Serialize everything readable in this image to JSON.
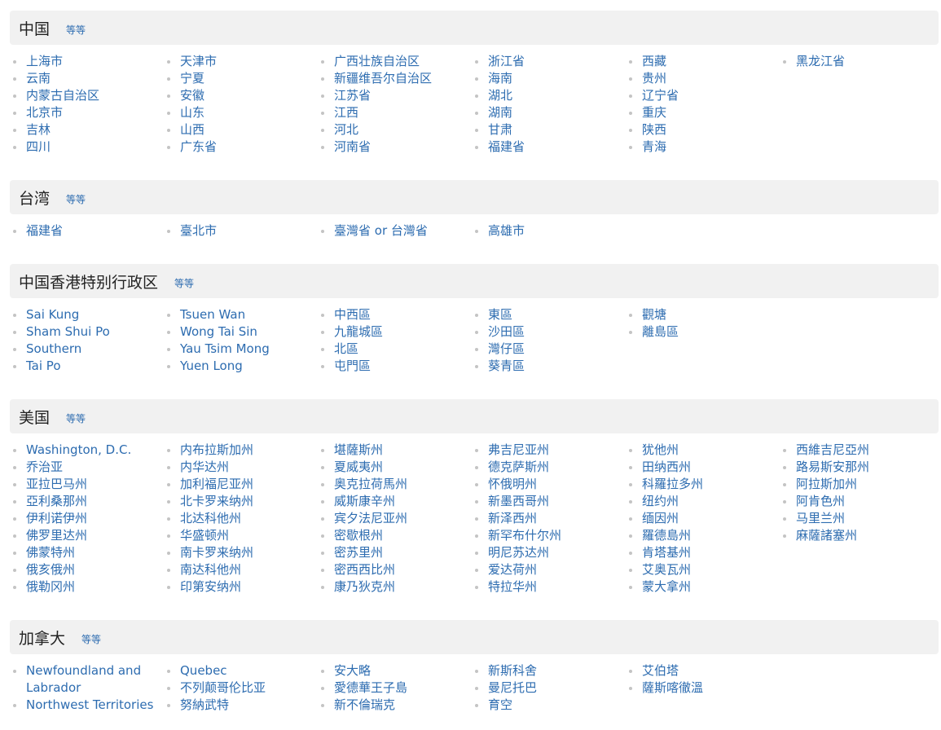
{
  "sections": [
    {
      "title": "中国",
      "more": "等等",
      "columns": [
        [
          "上海市",
          "云南",
          "内蒙古自治区",
          "北京市",
          "吉林",
          "四川"
        ],
        [
          "天津市",
          "宁夏",
          "安徽",
          "山东",
          "山西",
          "广东省"
        ],
        [
          "广西壮族自治区",
          "新疆维吾尔自治区",
          "江苏省",
          "江西",
          "河北",
          "河南省"
        ],
        [
          "浙江省",
          "海南",
          "湖北",
          "湖南",
          "甘肃",
          "福建省"
        ],
        [
          "西藏",
          "贵州",
          "辽宁省",
          "重庆",
          "陕西",
          "青海"
        ],
        [
          "黑龙江省"
        ]
      ]
    },
    {
      "title": "台湾",
      "more": "等等",
      "columns": [
        [
          "福建省"
        ],
        [
          "臺北市"
        ],
        [
          "臺灣省 or 台灣省"
        ],
        [
          "高雄市"
        ]
      ]
    },
    {
      "title": "中国香港特别行政区",
      "more": "等等",
      "columns": [
        [
          "Sai Kung",
          "Sham Shui Po",
          "Southern",
          "Tai Po"
        ],
        [
          "Tsuen Wan",
          "Wong Tai Sin",
          "Yau Tsim Mong",
          "Yuen Long"
        ],
        [
          "中西區",
          "九龍城區",
          "北區",
          "屯門區"
        ],
        [
          "東區",
          "沙田區",
          "灣仔區",
          "葵青區"
        ],
        [
          "觀塘",
          "離島區"
        ]
      ]
    },
    {
      "title": "美国",
      "more": "等等",
      "columns": [
        [
          "Washington, D.C.",
          "乔治亚",
          "亚拉巴马州",
          "亞利桑那州",
          "伊利诺伊州",
          "佛罗里达州",
          "佛蒙特州",
          "俄亥俄州",
          "俄勒冈州"
        ],
        [
          "内布拉斯加州",
          "内华达州",
          "加利福尼亚州",
          "北卡罗来纳州",
          "北达科他州",
          "华盛顿州",
          "南卡罗来纳州",
          "南达科他州",
          "印第安纳州"
        ],
        [
          "堪薩斯州",
          "夏威夷州",
          "奥克拉荷馬州",
          "威斯康辛州",
          "宾夕法尼亚州",
          "密歇根州",
          "密苏里州",
          "密西西比州",
          "康乃狄克州"
        ],
        [
          "弗吉尼亚州",
          "德克萨斯州",
          "怀俄明州",
          "新墨西哥州",
          "新泽西州",
          "新罕布什尔州",
          "明尼苏达州",
          "爱达荷州",
          "特拉华州"
        ],
        [
          "犹他州",
          "田纳西州",
          "科羅拉多州",
          "纽约州",
          "缅因州",
          "羅德島州",
          "肯塔基州",
          "艾奥瓦州",
          "蒙大拿州"
        ],
        [
          "西維吉尼亞州",
          "路易斯安那州",
          "阿拉斯加州",
          "阿肯色州",
          "马里兰州",
          "麻薩諸塞州"
        ]
      ]
    },
    {
      "title": "加拿大",
      "more": "等等",
      "columns": [
        [
          "Newfoundland and Labrador",
          "Northwest Territories"
        ],
        [
          "Quebec",
          "不列颠哥伦比亚",
          "努納武特"
        ],
        [
          "安大略",
          "愛德華王子島",
          "新不倫瑞克"
        ],
        [
          "新斯科舍",
          "曼尼托巴",
          "育空"
        ],
        [
          "艾伯塔",
          "薩斯喀徹溫"
        ]
      ]
    }
  ]
}
